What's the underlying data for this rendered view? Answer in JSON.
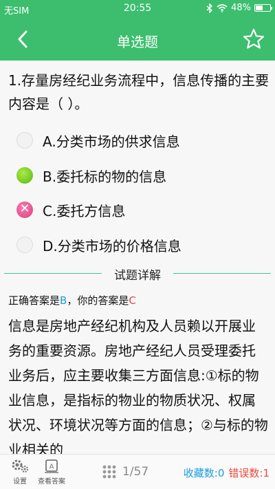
{
  "status_bar": {
    "carrier": "无SIM",
    "time": "20:55",
    "battery": "48%",
    "battery_level": 0.48
  },
  "nav": {
    "title": "单选题",
    "back_icon": "chevron-left-icon",
    "favorite_icon": "star-outline-icon"
  },
  "question": {
    "text": "1.存量房经纪业务流程中，信息传播的主要内容是（ ）。",
    "options": [
      {
        "label": "A.分类市场的供求信息",
        "state": "unselected"
      },
      {
        "label": "B.委托标的物的信息",
        "state": "correct"
      },
      {
        "label": "C.委托方信息",
        "state": "wrong"
      },
      {
        "label": "D.分类市场的价格信息",
        "state": "unselected"
      }
    ]
  },
  "explanation": {
    "section_title": "试题详解",
    "correct_prefix": "正确答案是",
    "correct_answer": "B",
    "your_prefix": "，你的答案是",
    "your_answer": "C",
    "body": "信息是房地产经纪机构及人员赖以开展业务的重要资源。房地产经纪人员受理委托业务后，应主要收集三方面信息:①标的物业信息，是指标的物业的物质状况、权属状况、环境状况等方面的信息；②与标的物业相关的"
  },
  "bottom_bar": {
    "settings_label": "设置",
    "view_answer_label": "查看答案",
    "pager": "1/57",
    "favorites": "收藏数:0",
    "errors": "错误数:1"
  },
  "colors": {
    "brand": "#3cbe6e",
    "correct": "#58b80f",
    "wrong": "#e0417f",
    "blue": "#1a9be0",
    "red": "#e8493b"
  }
}
